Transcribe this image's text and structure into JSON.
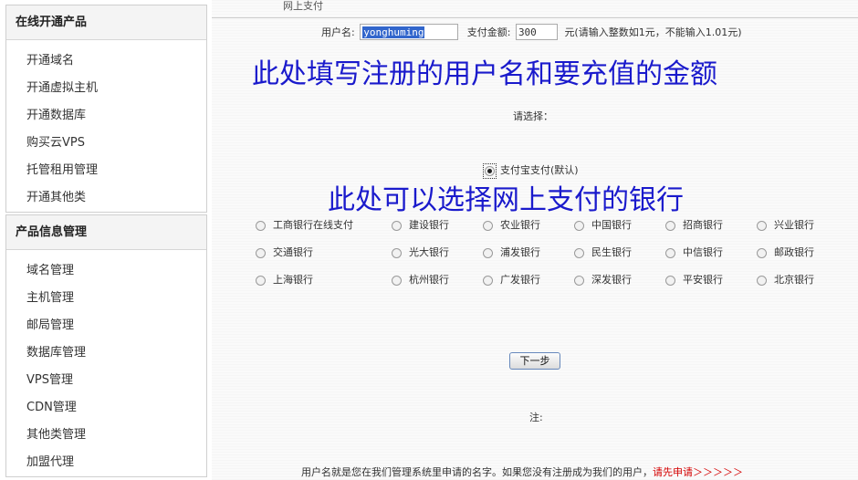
{
  "sidebar": {
    "sections": [
      {
        "title": "在线开通产品",
        "items": [
          "开通域名",
          "开通虚拟主机",
          "开通数据库",
          "购买云VPS",
          "托管租用管理",
          "开通其他类"
        ]
      },
      {
        "title": "产品信息管理",
        "items": [
          "域名管理",
          "主机管理",
          "邮局管理",
          "数据库管理",
          "VPS管理",
          "CDN管理",
          "其他类管理",
          "加盟代理"
        ]
      }
    ]
  },
  "main": {
    "breadcrumb": "网上支付",
    "form": {
      "username_label": "用户名:",
      "username_value": "yonghuming",
      "amount_label": "支付金额:",
      "amount_value": "300",
      "amount_hint": "元(请输入整数如1元，不能输入1.01元)"
    },
    "annotation_top": "此处填写注册的用户名和要充值的金额",
    "choose_label": "请选择：",
    "alipay_label": "支付宝支付(默认)",
    "annotation_bank": "此处可以选择网上支付的银行",
    "banks": [
      [
        "工商银行在线支付",
        "建设银行",
        "农业银行",
        "中国银行",
        "招商银行",
        "兴业银行"
      ],
      [
        "交通银行",
        "光大银行",
        "浦发银行",
        "民生银行",
        "中信银行",
        "邮政银行"
      ],
      [
        "上海银行",
        "杭州银行",
        "广发银行",
        "深发银行",
        "平安银行",
        "北京银行"
      ]
    ],
    "next_button": "下一步",
    "note_label": "注:",
    "footer_text": "用户名就是您在我们管理系统里申请的名字。如果您没有注册成为我们的用户，",
    "footer_link": "请先申请＞＞＞＞＞"
  }
}
